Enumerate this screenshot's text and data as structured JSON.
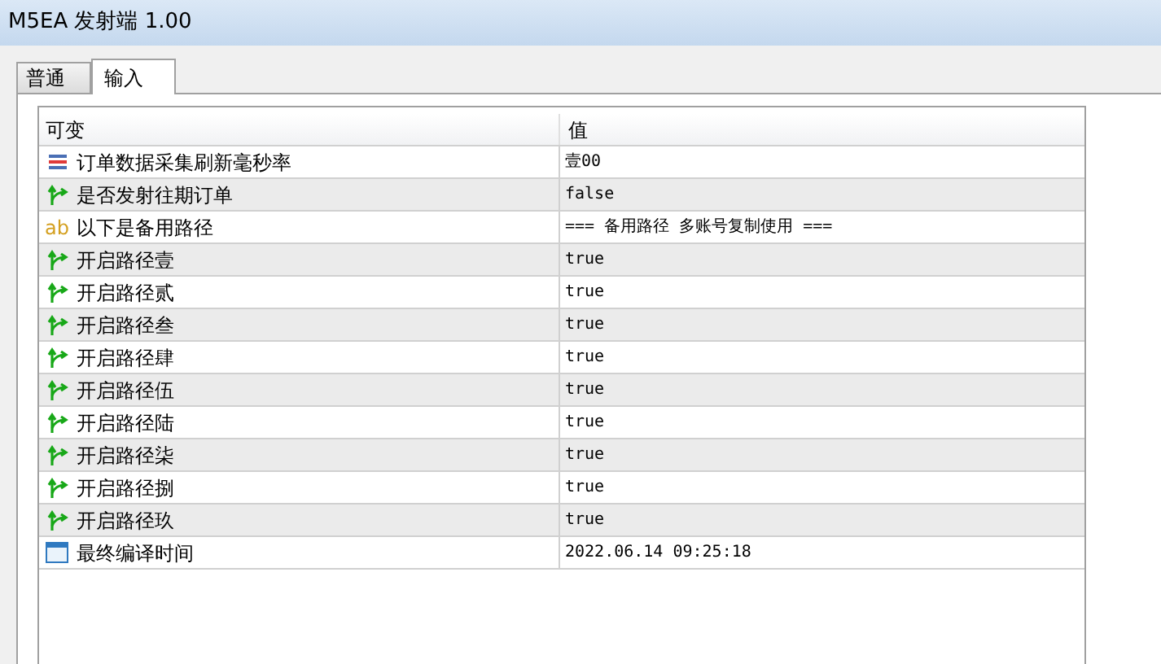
{
  "window": {
    "title": "M5EA 发射端 1.00"
  },
  "tabs": [
    {
      "label": "普通",
      "selected": false
    },
    {
      "label": "输入",
      "selected": true
    }
  ],
  "table": {
    "columns": [
      "可变",
      "值"
    ],
    "rows": [
      {
        "kind": "int",
        "name": "订单数据采集刷新毫秒率",
        "value": "壹00"
      },
      {
        "kind": "bool",
        "name": "是否发射往期订单",
        "value": "false"
      },
      {
        "kind": "string",
        "icon": "ab",
        "name": "以下是备用路径",
        "value": "=== 备用路径 多账号复制使用 ==="
      },
      {
        "kind": "bool",
        "name": "开启路径壹",
        "value": "true"
      },
      {
        "kind": "bool",
        "name": "开启路径贰",
        "value": "true"
      },
      {
        "kind": "bool",
        "name": "开启路径叁",
        "value": "true"
      },
      {
        "kind": "bool",
        "name": "开启路径肆",
        "value": "true"
      },
      {
        "kind": "bool",
        "name": "开启路径伍",
        "value": "true"
      },
      {
        "kind": "bool",
        "name": "开启路径陆",
        "value": "true"
      },
      {
        "kind": "bool",
        "name": "开启路径柒",
        "value": "true"
      },
      {
        "kind": "bool",
        "name": "开启路径捌",
        "value": "true"
      },
      {
        "kind": "bool",
        "name": "开启路径玖",
        "value": "true"
      },
      {
        "kind": "datetime",
        "name": "最终编译时间",
        "value": "2022.06.14 09:25:18"
      }
    ]
  }
}
